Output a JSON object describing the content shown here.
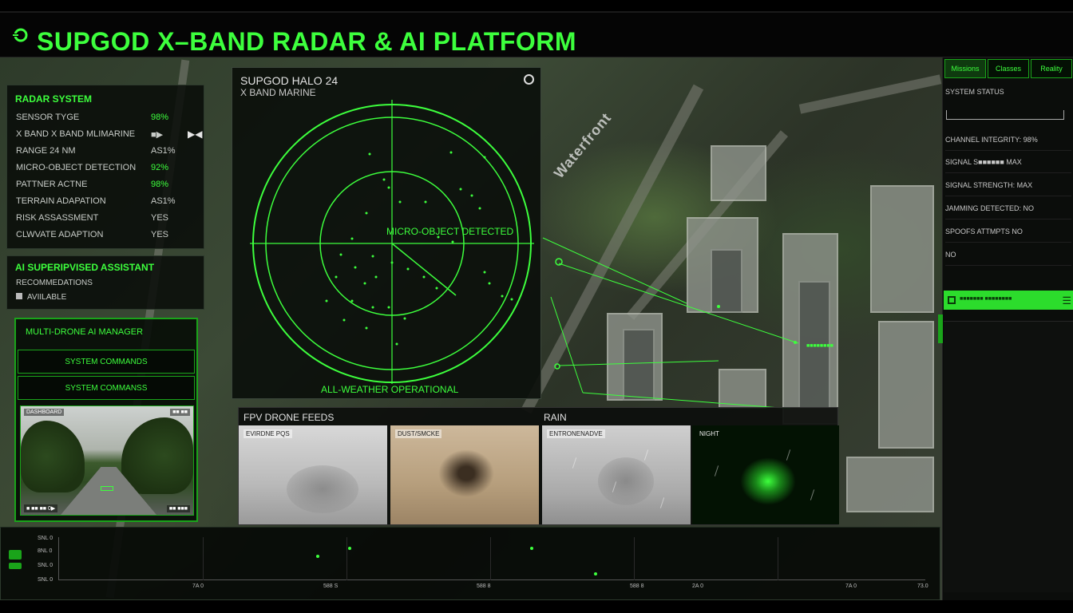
{
  "header": {
    "title": "SUPGOD X–BAND RADAR & AI PLATFORM"
  },
  "radar_system": {
    "title": "RADAR SYSTEM",
    "rows": [
      {
        "label": "SENSOR TYGE",
        "value": "98%",
        "value_color": "green"
      },
      {
        "label": "X BAND X BAND MLIMARINE",
        "value": "■▶",
        "icon": "▶◀"
      },
      {
        "label": "RANGE 24 NM",
        "value": "AS1%"
      },
      {
        "label": "MICRO-OBJECT DETECTION",
        "value": "92%",
        "value_color": "green"
      },
      {
        "label": "PATTNER ACTNE",
        "value": "98%",
        "value_color": "green"
      },
      {
        "label": "TERRAIN ADAPATION",
        "value": "AS1%"
      },
      {
        "label": "RISK ASSASSMENT",
        "value": "YES"
      },
      {
        "label": "CLWVATE ADAPTION",
        "value": "YES"
      }
    ]
  },
  "assistant": {
    "title": "AI SUPERIPVISED ASSISTANT",
    "subtitle": "RECOMMEDATIONS",
    "status": "AVIILABLE"
  },
  "drone_manager": {
    "title": "MULTI-DRONE AI MANAGER",
    "command_buttons": [
      "SYSTEM COMMANDS",
      "SYSTEM COMMANSS"
    ],
    "cam_labels": {
      "top_left": "DASHBOARD",
      "top_right": "■■ ■■",
      "bottom_left": "■ ■■ ■■ 0▶",
      "bottom_right": "■■ ■■■"
    }
  },
  "radar_scope": {
    "title": "SUPGOD HALO 24",
    "subtitle": "X BAND MARINE",
    "detect_label": "MICRO-OBJECT DETECTED",
    "status_label": "ALL-WEATHER OPERATIONAL"
  },
  "fpv": {
    "title": "FPV DRONE FEEDS",
    "rain_label": "RAIN",
    "feeds": [
      {
        "label": "EVIRDNE PQS"
      },
      {
        "label": "DUST/SMCKE"
      },
      {
        "label": "ENTRONENADVE"
      },
      {
        "label": "NIGHT"
      }
    ]
  },
  "map": {
    "street": "Waterfront",
    "building_tag": "■■■■■■■■"
  },
  "timeline": {
    "y_labels": [
      "SNL 0",
      "8NL 0",
      "SNL 0",
      "SNL 0"
    ],
    "x_labels": [
      "7A 0",
      "588 S",
      "588 8",
      "588 8",
      "2A 0",
      "7A 0",
      "73.0"
    ]
  },
  "sidebar": {
    "tabs": [
      "Missions",
      "Classes",
      "Reality"
    ],
    "status_title": "SYSTEM STATUS",
    "rows": [
      "CHANNEL INTEGRITY: 98%",
      "SIGNAL S■■■■■■ MAX",
      "SIGNAL STRENGTH: MAX",
      "JAMMING DETECTED: NO",
      "SPOOFS ATTMPTS  NO",
      "NO"
    ],
    "alert_text": "■■■■■■■ ■■■■■■■■"
  },
  "colors": {
    "accent": "#3dff3d",
    "panel": "#080c08",
    "border": "#1aa41a"
  },
  "icons": [
    "logo-icon",
    "close-icon",
    "radar-scope",
    "camera-feed",
    "menu-icon"
  ]
}
